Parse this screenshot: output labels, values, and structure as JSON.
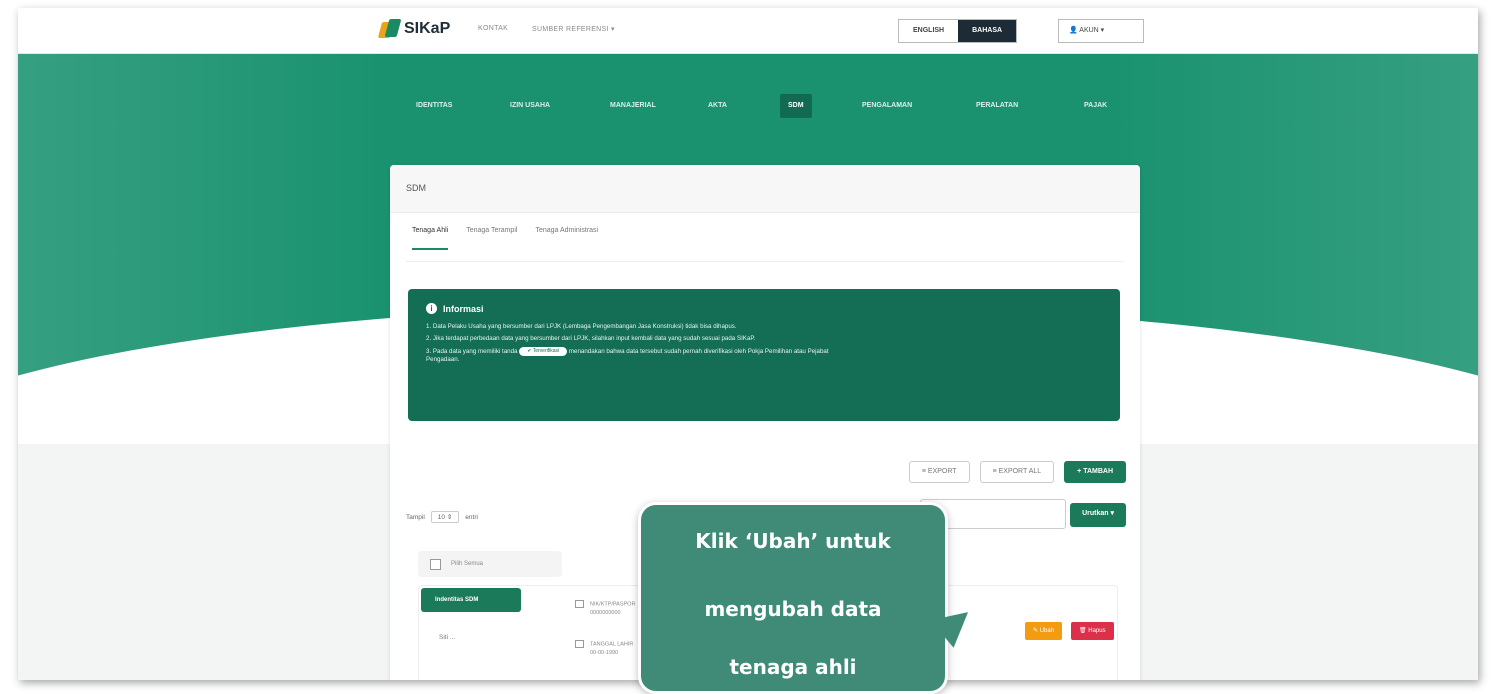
{
  "brand": {
    "name": "SIKaP"
  },
  "topbar": {
    "links": [
      "KONTAK",
      "SUMBER REFERENSI ▾"
    ],
    "lang_en": "ENGLISH",
    "lang_id": "BAHASA",
    "akun": "AKUN ▾"
  },
  "nav": {
    "items": [
      "IDENTITAS",
      "IZIN USAHA",
      "MANAJERIAL",
      "AKTA",
      "SDM",
      "PENGALAMAN",
      "PERALATAN",
      "PAJAK"
    ],
    "active": "SDM"
  },
  "card": {
    "title": "SDM",
    "tabs": [
      "Tenaga Ahli",
      "Tenaga Terampil",
      "Tenaga Administrasi"
    ],
    "info": {
      "title": "Informasi",
      "line1": "1. Data Pelaku Usaha yang bersumber dari LPJK (Lembaga Pengembangan Jasa Konstruksi) tidak bisa dihapus.",
      "line2": "2. Jika terdapat perbedaan data yang bersumber dari LPJK, silahkan input kembali data yang sudah sesuai pada SIKaP.",
      "line3a": "3. Pada data yang memiliki tanda",
      "pill": "✔ Terverifikasi",
      "line3b": "menandakan bahwa data tersebut sudah pernah diverifikasi oleh Pokja Pemilihan atau Pejabat",
      "line3c": "Pengadaan."
    },
    "buttons": {
      "export": "≡ EXPORT",
      "export_all": "≡ EXPORT ALL",
      "tambah": "+ TAMBAH"
    },
    "show": {
      "label_before": "Tampil",
      "value": "10 ⇕",
      "label_after": "entri"
    },
    "sort": "Urutkan ▾",
    "checkall": "Pilih Semua",
    "row": {
      "tag": "Indentitas SDM",
      "name": "Siti ...",
      "meta1_label": "NIK/KTP/PASPOR",
      "meta1_value": "0000000000",
      "meta2_label": "TANGGAL LAHIR",
      "meta2_value": "00-00-1990",
      "ubah": "✎ Ubah",
      "hapus": "🗑 Hapus"
    }
  },
  "callout": {
    "line1": "Klik ‘Ubah’ untuk",
    "line2": "mengubah data",
    "line3": "tenaga ahli"
  },
  "colors": {
    "primary": "#1a9270",
    "dark": "#136e55",
    "callout": "#3f8b78",
    "edit": "#f39c12",
    "delete": "#dc2f4a"
  }
}
